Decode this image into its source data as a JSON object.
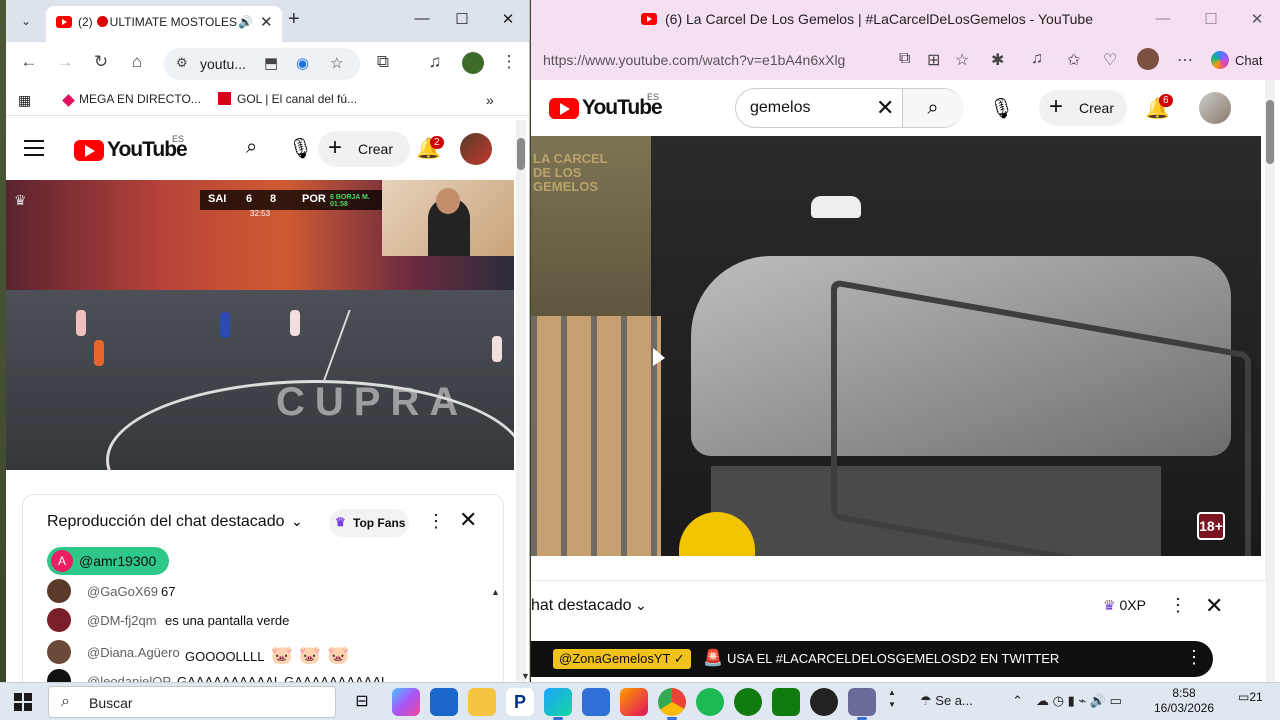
{
  "left_window": {
    "tab": {
      "count_prefix": "(2)",
      "title": "ULTIMATE MOSTOLES"
    },
    "omnibox": {
      "url": "youtu..."
    },
    "bookmarks": [
      {
        "label": "MEGA EN DIRECTO..."
      },
      {
        "label": "GOL | El canal del fú..."
      }
    ],
    "youtube": {
      "logo": "YouTube",
      "region": "ES",
      "create_label": "Crear",
      "notif_count": "2"
    },
    "video": {
      "team_left": "SAI",
      "score_left": "6",
      "score_right": "8",
      "team_right": "POR",
      "clock": "32:53",
      "event": "6 BORJA M. 01:58",
      "court_text": "CUPRA"
    },
    "chat": {
      "title": "Reproducción del chat destacado",
      "top_fans_label": "Top Fans",
      "pinned_user": {
        "initial": "A",
        "name": "@amr19300"
      },
      "messages": [
        {
          "author": "@GaGoX69",
          "text": "67"
        },
        {
          "author": "@DM-fj2qm",
          "text": "es una pantalla verde"
        },
        {
          "author": "@Diana.Agüero",
          "text": "GOOOOLLLL",
          "emojis": [
            "🐷",
            "🐷",
            "🐷"
          ]
        },
        {
          "author": "@leodanielOP",
          "text": "GAAAAAAAAAAL GAAAAAAAAAAL"
        }
      ]
    }
  },
  "right_window": {
    "title": "(6) La Carcel De Los Gemelos | #LaCarcelDeLosGemelos - YouTube",
    "url": "https://www.youtube.com/watch?v=e1bA4n6xXlg",
    "chat_label": "Chat",
    "youtube": {
      "logo": "YouTube",
      "region": "ES",
      "search_value": "gemelos",
      "create_label": "Crear",
      "notif_count": "6"
    },
    "video": {
      "logo_line1": "LA CARCEL",
      "logo_line2": "DE LOS",
      "logo_line3": "GEMELOS",
      "rating": "18+"
    },
    "chat": {
      "title_partial": "hat destacado",
      "xp_label": "0XP",
      "banner_user": "@ZonaGemelosYT",
      "banner_text": "USA EL #LACARCELDELOSGEMELOSD2 EN TWITTER"
    }
  },
  "taskbar": {
    "search_placeholder": "Buscar",
    "weather_label": "Se a...",
    "time": "8:58",
    "date": "16/03/2026",
    "notifications": "21"
  }
}
